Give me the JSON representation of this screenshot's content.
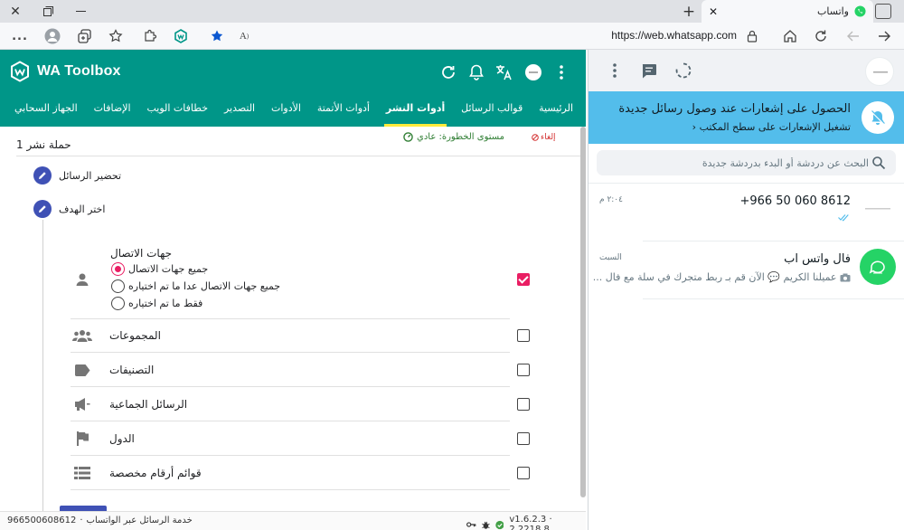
{
  "browser": {
    "tab_title": "واتساب",
    "url": "https://web.whatsapp.com",
    "more_label": "..."
  },
  "extension": {
    "brand": "WA Toolbox",
    "nav_tabs": [
      "الجهاز السحابي",
      "الإضافات",
      "خطافات الويب",
      "التصدير",
      "الأدوات",
      "أدوات الأتمتة",
      "أدوات النشر",
      "قوالب الرسائل",
      "الرئيسية"
    ],
    "active_tab": "أدوات النشر",
    "campaign_title": "حملة نشر 1",
    "risk_level": "مستوى الخطورة: عادي",
    "cancel": "إلغاء",
    "steps": [
      "تحضير الرسائل",
      "اختر الهدف"
    ],
    "contacts": {
      "heading": "جهات الاتصال",
      "options": [
        {
          "label": "جميع جهات الاتصال",
          "selected": true
        },
        {
          "label": "جميع جهات الاتصال عدا ما تم اختياره",
          "selected": false
        },
        {
          "label": "فقط ما تم اختياره",
          "selected": false
        }
      ],
      "checked": true
    },
    "targets": [
      {
        "label": "المجموعات",
        "icon": "groups-icon",
        "checked": false
      },
      {
        "label": "التصنيفات",
        "icon": "label-icon",
        "checked": false
      },
      {
        "label": "الرسائل الجماعية",
        "icon": "megaphone-icon",
        "checked": false
      },
      {
        "label": "الدول",
        "icon": "flag-icon",
        "checked": false
      },
      {
        "label": "قوائم أرقام مخصصة",
        "icon": "list-icon",
        "checked": false
      }
    ],
    "footer": {
      "phone": "966500608612",
      "service": "خدمة الرسائل عبر الواتساب",
      "version": "v1.6.2.3 · 2.2218.8"
    },
    "colors": {
      "header": "#009688",
      "accent": "#e91e63",
      "step": "#3f51b5",
      "tab_underline": "#ffeb3b"
    }
  },
  "whatsapp": {
    "notification": {
      "title": "الحصول على إشعارات عند وصول رسائل جديدة",
      "subtitle": "تشغيل الإشعارات على سطح المكتب"
    },
    "search_placeholder": "البحث عن دردشة أو البدء بدردشة جديدة",
    "chats": [
      {
        "name": "+966 50 060 8612",
        "time": "٢:٠٤ م",
        "preview": ""
      },
      {
        "name": "فال واتس اب",
        "time": "السبت",
        "preview": "عميلنا الكريم 💬 الآن قم بـ ربط متجرك في سلة مع فال ..."
      }
    ],
    "colors": {
      "banner": "#53bdeb",
      "brand": "#25d366"
    }
  }
}
